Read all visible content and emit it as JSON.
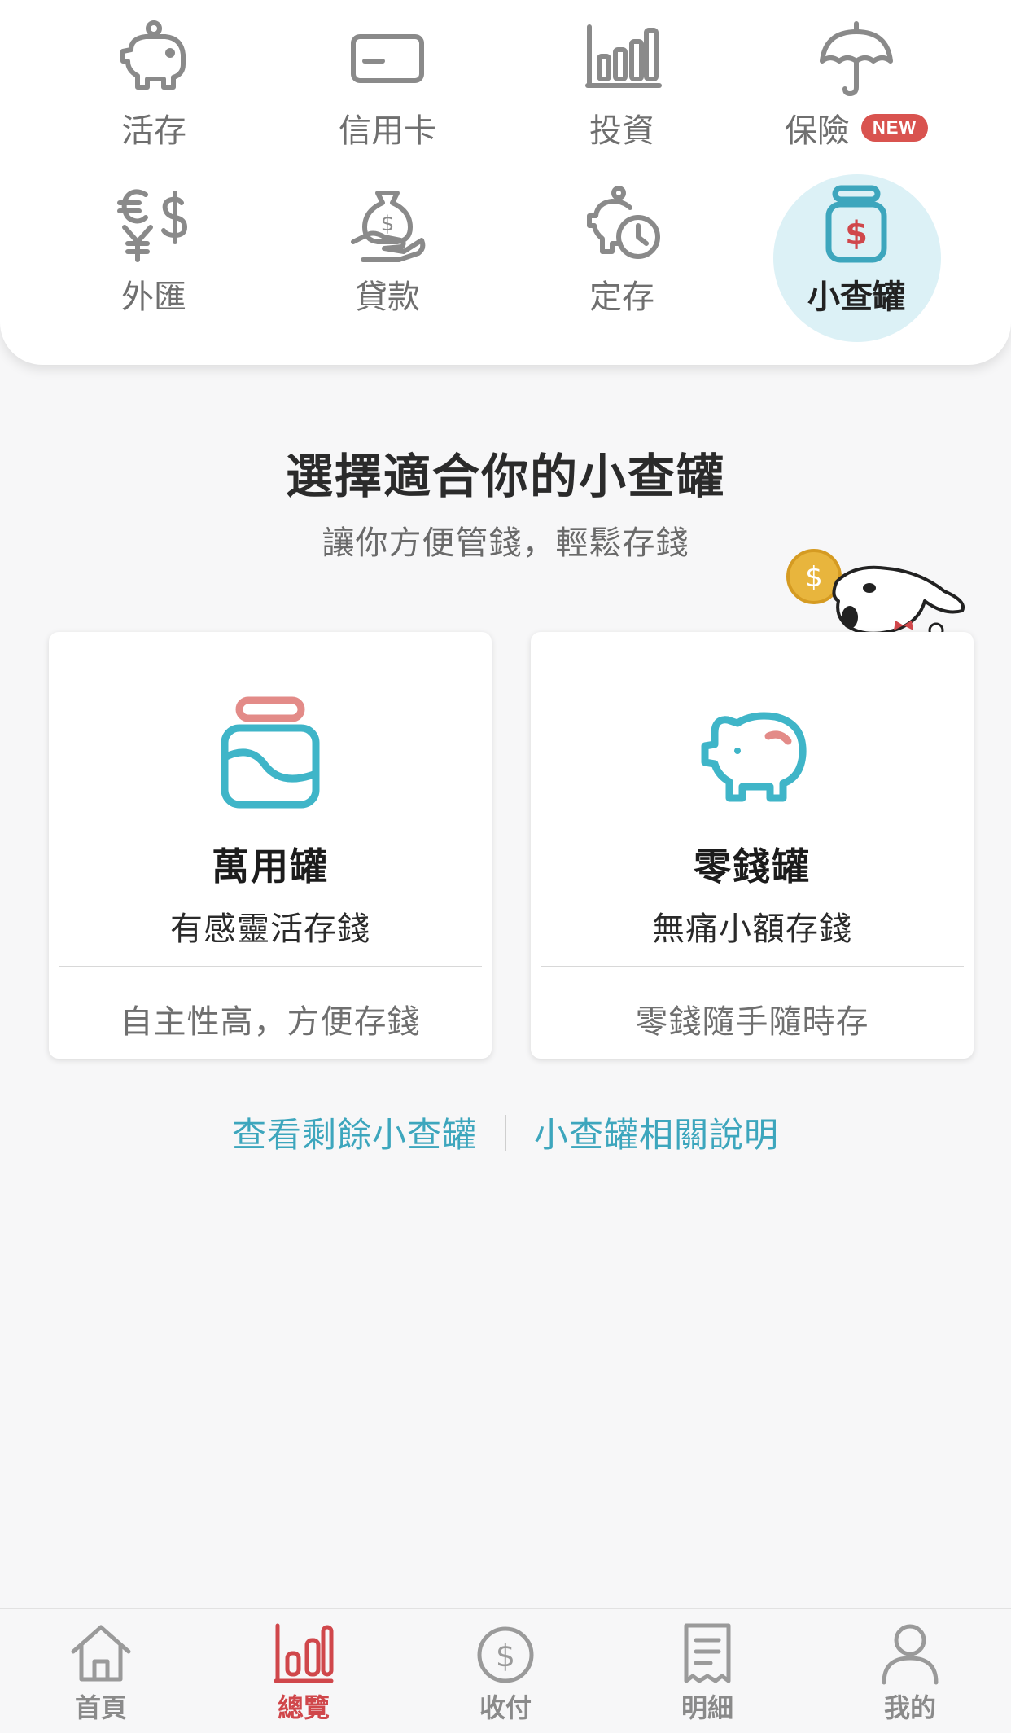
{
  "categories": [
    {
      "label": "活存",
      "icon": "piggy-bank-icon"
    },
    {
      "label": "信用卡",
      "icon": "credit-card-icon"
    },
    {
      "label": "投資",
      "icon": "bar-chart-icon"
    },
    {
      "label": "保險",
      "icon": "umbrella-icon",
      "badge": "NEW"
    },
    {
      "label": "外匯",
      "icon": "currency-exchange-icon"
    },
    {
      "label": "貸款",
      "icon": "loan-bag-icon"
    },
    {
      "label": "定存",
      "icon": "piggy-clock-icon"
    },
    {
      "label": "小查罐",
      "icon": "jar-dollar-icon",
      "active": true
    }
  ],
  "heading": {
    "title": "選擇適合你的小查罐",
    "subtitle": "讓你方便管錢，輕鬆存錢"
  },
  "mascot": {
    "coin_symbol": "$"
  },
  "cards": [
    {
      "title": "萬用罐",
      "description": "有感靈活存錢",
      "note": "自主性高，方便存錢",
      "icon": "wave-jar-icon"
    },
    {
      "title": "零錢罐",
      "description": "無痛小額存錢",
      "note": "零錢隨手隨時存",
      "icon": "piggy-icon"
    }
  ],
  "links": {
    "remaining": "查看剩餘小查罐",
    "help": "小查罐相關說明"
  },
  "bottom_nav": [
    {
      "label": "首頁",
      "icon": "home-icon"
    },
    {
      "label": "總覽",
      "icon": "overview-icon",
      "active": true
    },
    {
      "label": "收付",
      "icon": "dollar-circle-icon"
    },
    {
      "label": "明細",
      "icon": "receipt-icon"
    },
    {
      "label": "我的",
      "icon": "user-icon"
    }
  ],
  "colors": {
    "accent_red": "#d0474b",
    "accent_teal": "#3da6bd",
    "active_bg": "#dcf1f6",
    "badge_red": "#d9534f"
  }
}
